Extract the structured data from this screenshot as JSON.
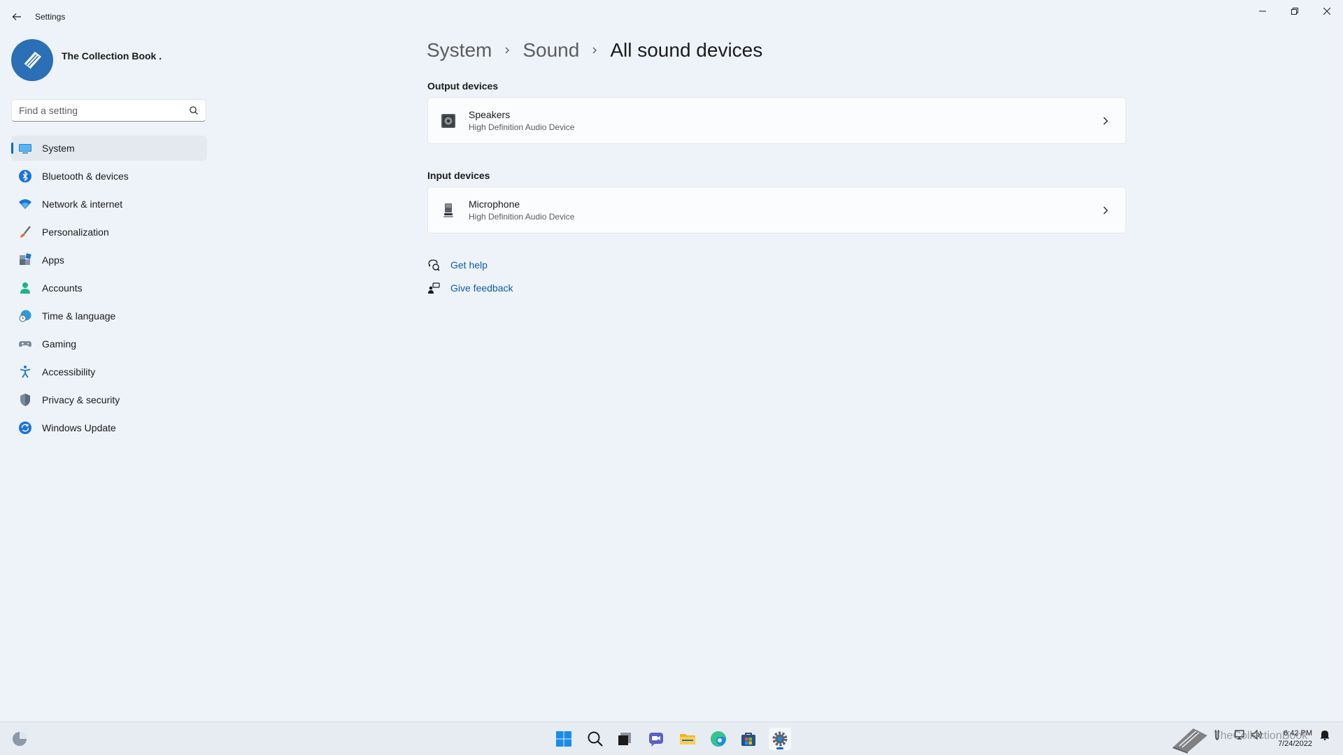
{
  "window": {
    "title": "Settings",
    "back_icon": "back-arrow-icon",
    "controls": [
      "minimize-icon",
      "restore-icon",
      "close-icon"
    ]
  },
  "profile": {
    "name": "The Collection Book ."
  },
  "search": {
    "placeholder": "Find a setting",
    "value": ""
  },
  "sidebar": {
    "items": [
      {
        "label": "System",
        "icon": "system-icon",
        "active": true
      },
      {
        "label": "Bluetooth & devices",
        "icon": "bluetooth-icon"
      },
      {
        "label": "Network & internet",
        "icon": "wifi-icon"
      },
      {
        "label": "Personalization",
        "icon": "brush-icon"
      },
      {
        "label": "Apps",
        "icon": "apps-icon"
      },
      {
        "label": "Accounts",
        "icon": "account-icon"
      },
      {
        "label": "Time & language",
        "icon": "globe-clock-icon"
      },
      {
        "label": "Gaming",
        "icon": "gamepad-icon"
      },
      {
        "label": "Accessibility",
        "icon": "accessibility-icon"
      },
      {
        "label": "Privacy & security",
        "icon": "shield-icon"
      },
      {
        "label": "Windows Update",
        "icon": "update-icon"
      }
    ]
  },
  "breadcrumb": {
    "items": [
      "System",
      "Sound"
    ],
    "current": "All sound devices"
  },
  "output": {
    "title": "Output devices",
    "devices": [
      {
        "name": "Speakers",
        "description": "High Definition Audio Device",
        "icon": "speaker-icon"
      }
    ]
  },
  "input": {
    "title": "Input devices",
    "devices": [
      {
        "name": "Microphone",
        "description": "High Definition Audio Device",
        "icon": "microphone-icon"
      }
    ]
  },
  "links": {
    "help": "Get help",
    "feedback": "Give feedback"
  },
  "taskbar": {
    "apps": [
      "start-icon",
      "search-icon",
      "task-view-icon",
      "chat-icon",
      "file-explorer-icon",
      "edge-icon",
      "store-icon",
      "settings-icon"
    ],
    "active_app": "settings-icon",
    "clock": {
      "time": "6:42 PM",
      "date": "7/24/2022"
    },
    "watermark_text": "TheCollectionBook"
  },
  "colors": {
    "accent": "#0067c0",
    "link": "#0a5dad",
    "background": "#eef3f9"
  }
}
